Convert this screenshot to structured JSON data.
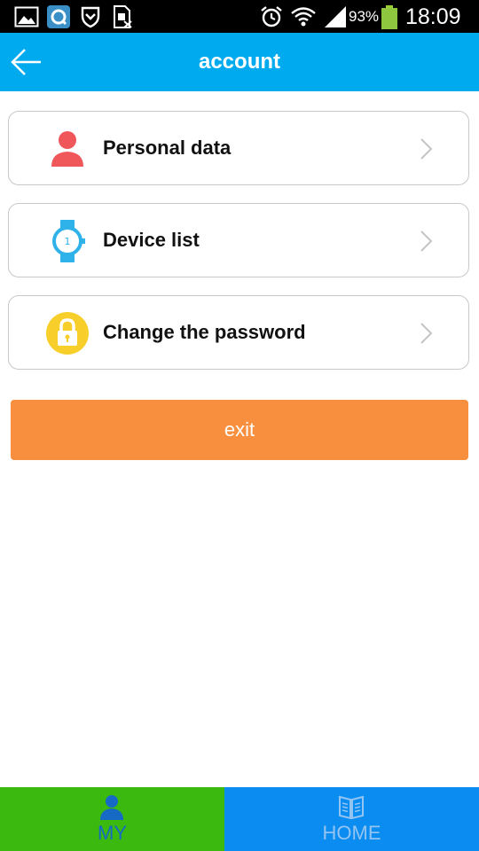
{
  "status_bar": {
    "battery_percent": "93%",
    "time": "18:09",
    "icons": [
      "gallery-icon",
      "q-app-icon",
      "shield-icon",
      "sim-icon",
      "alarm-icon",
      "wifi-icon",
      "signal-icon",
      "battery-icon"
    ]
  },
  "header": {
    "title": "account",
    "back_icon": "arrow-left-icon"
  },
  "menu": {
    "items": [
      {
        "label": "Personal data",
        "icon": "person-icon"
      },
      {
        "label": "Device list",
        "icon": "watch-icon"
      },
      {
        "label": "Change the password",
        "icon": "lock-icon"
      }
    ]
  },
  "exit": {
    "label": "exit"
  },
  "bottom_nav": {
    "tabs": [
      {
        "label": "MY",
        "icon": "person-icon",
        "active": true
      },
      {
        "label": "HOME",
        "icon": "book-icon",
        "active": false
      }
    ]
  },
  "colors": {
    "header_bg": "#00AAEF",
    "exit_bg": "#F78F3F",
    "nav_my_bg": "#3CB90E",
    "nav_home_bg": "#0A8CF0",
    "nav_my_fg": "#1769C6",
    "nav_home_fg": "#93C4F2",
    "person_icon": "#F0575A",
    "watch_icon": "#2FB1EA",
    "lock_icon": "#F8CF2A",
    "item_border": "#C8C8C8"
  }
}
